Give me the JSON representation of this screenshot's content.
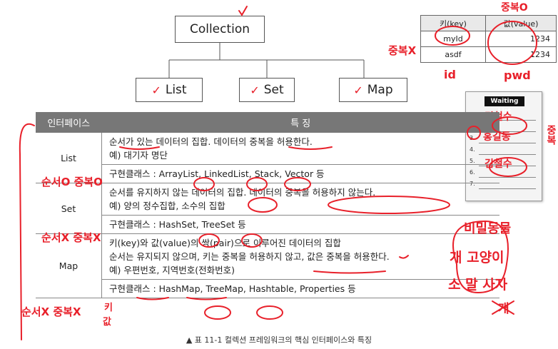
{
  "diagram": {
    "root": "Collection",
    "children": [
      "List",
      "Set",
      "Map"
    ],
    "check_glyph": "✓"
  },
  "kv_table": {
    "headers": [
      "키(key)",
      "값(value)"
    ],
    "rows": [
      [
        "myId",
        "1234"
      ],
      [
        "asdf",
        "1234"
      ]
    ]
  },
  "table": {
    "headers": [
      "인터페이스",
      "특 징"
    ],
    "rows": [
      {
        "name": "List",
        "desc": [
          "순서가 있는 데이터의 집합. 데이터의 중복을 허용한다.",
          "예) 대기자 명단"
        ],
        "impl": "구현클래스 : ArrayList, LinkedList, Stack, Vector 등"
      },
      {
        "name": "Set",
        "desc": [
          "순서를 유지하지 않는 데이터의 집합. 데이터의 중복을 허용하지 않는다.",
          "예) 양의 정수집합, 소수의 집합"
        ],
        "impl": "구현클래스 : HashSet, TreeSet 등"
      },
      {
        "name": "Map",
        "desc": [
          "키(key)와 값(value)의 쌍(pair)으로 이루어진 데이터의 집합",
          "순서는 유지되지 않으며, 키는 중복을 허용하지 않고, 값은 중복을 허용한다.",
          "예) 우편번호, 지역번호(전화번호)"
        ],
        "impl": "구현클래스 : HashMap, TreeMap, Hashtable, Properties 등"
      }
    ]
  },
  "caption": "▲ 표 11-1  컬렉션 프레임워크의 핵심 인터페이스와 특징",
  "notepad": {
    "title": "Waiting List",
    "numbers": [
      "1.",
      "2.",
      "3.",
      "4.",
      "5.",
      "6.",
      "7."
    ],
    "entries": [
      "김철수",
      "홍길동",
      "",
      "",
      "김철수",
      "",
      ""
    ]
  },
  "annotations": {
    "id": "id",
    "pwd": "pwd",
    "dup_x": "중복X",
    "dup_o": "중복O",
    "dup_right": "중복",
    "list_note": "순서O 중복O",
    "set_note": "순서X 중복X",
    "map_note": "순서X 중복X",
    "map_key": "키",
    "map_val": "값",
    "animals_title": "비밀동물",
    "animals_1": "개 고양이",
    "animals_2": "소 말 사자",
    "animals_3": "개"
  },
  "colors": {
    "ink": "#e8202a",
    "header_bg": "#777777"
  }
}
